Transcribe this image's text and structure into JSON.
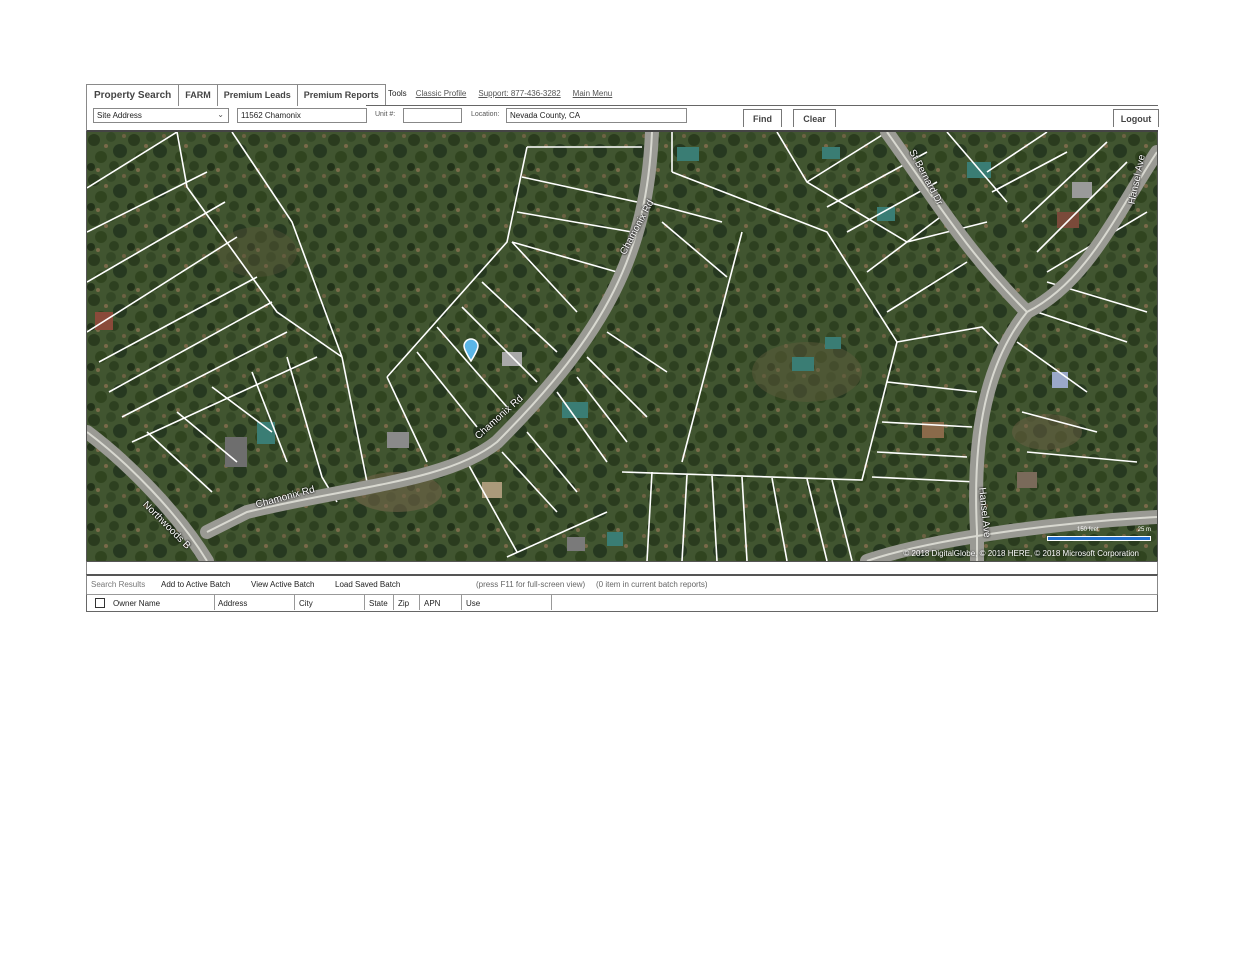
{
  "nav": {
    "tabs": [
      {
        "label": "Property Search"
      },
      {
        "label": "FARM"
      },
      {
        "label": "Premium Leads"
      },
      {
        "label": "Premium Reports"
      }
    ],
    "tools_label": "Tools",
    "links": [
      {
        "label": "Classic Profile"
      },
      {
        "label": "Support: 877-436-3282"
      },
      {
        "label": "Main Menu"
      }
    ]
  },
  "search": {
    "type_value": "Site Address",
    "address_value": "11562 Chamonix",
    "unit_label": "Unit #:",
    "unit_value": "",
    "location_label": "Location:",
    "location_value": "Nevada County, CA",
    "find_label": "Find",
    "clear_label": "Clear",
    "logout_label": "Logout"
  },
  "map": {
    "road_labels": {
      "chamonix_upper": "Chamonix Rd",
      "chamonix_mid": "Chamonix Rd",
      "chamonix_lower": "Chamonix Rd",
      "northwoods": "Northwoods B",
      "st_bernard": "St Bernard Dr",
      "hansel_right": "Hansel Ave",
      "hansel_mid": "Hansel Ave"
    },
    "attribution": "© 2018 DigitalGlobe, © 2018 HERE, © 2018 Microsoft Corporation",
    "scale_ft": "150 feet",
    "scale_m": "25 m",
    "pin_color": "#5bb6e6"
  },
  "results": {
    "toolbar": {
      "search_results": "Search Results",
      "add_batch": "Add to Active Batch",
      "view_batch": "View Active Batch",
      "load_batch": "Load Saved Batch",
      "hint": "(press F11 for full-screen view)",
      "batch_count": "(0 item in current batch reports)"
    },
    "columns": {
      "owner": "Owner Name",
      "address": "Address",
      "city": "City",
      "state": "State",
      "zip": "Zip",
      "apn": "APN",
      "use": "Use"
    }
  }
}
